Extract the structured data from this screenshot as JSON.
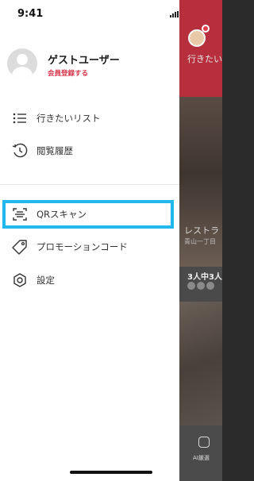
{
  "status_bar": {
    "time": "9:41"
  },
  "profile": {
    "name": "ゲストユーザー",
    "register_label": "会員登録する"
  },
  "menu": {
    "items": [
      {
        "icon": "list-icon",
        "label": "行きたいリスト"
      },
      {
        "icon": "history-icon",
        "label": "閲覧履歴"
      },
      {
        "icon": "qr-scan-icon",
        "label": "QRスキャン"
      },
      {
        "icon": "tag-icon",
        "label": "プロモーションコード"
      },
      {
        "icon": "gear-icon",
        "label": "設定"
      }
    ]
  },
  "background_app": {
    "want_list_label": "行きたい",
    "restaurant_label": "レストラ",
    "restaurant_sub": "青山一丁目",
    "count_label": "3人中3人",
    "ai_label": "AI厳選"
  },
  "colors": {
    "accent_red": "#d9374b",
    "highlight_blue": "#22b8ef",
    "header_red": "#b72f3d"
  }
}
